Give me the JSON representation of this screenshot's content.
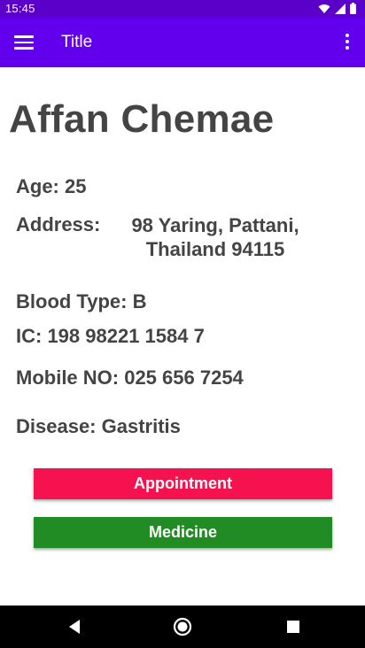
{
  "status_bar": {
    "time": "15:45"
  },
  "app_bar": {
    "title": "Title"
  },
  "profile": {
    "name": "Affan Chemae",
    "age": "Age: 25",
    "address_label": "Address:",
    "address_line1": "98 Yaring, Pattani,",
    "address_line2": "Thailand 94115",
    "blood_type": "Blood Type: B",
    "ic": "IC: 198 98221 1584 7",
    "mobile": "Mobile NO: 025 656 7254",
    "disease": "Disease: Gastritis"
  },
  "actions": {
    "appointment_label": "Appointment",
    "medicine_label": "Medicine"
  },
  "colors": {
    "status_bar": "#5b00c9",
    "app_bar": "#6200ee",
    "appointment_button": "#f5124e",
    "medicine_button": "#218b24",
    "nav_bar": "#000000"
  },
  "icons": [
    "wifi-icon",
    "signal-icon",
    "battery-icon",
    "menu-icon",
    "more-vert-icon",
    "back-icon",
    "home-icon",
    "recents-icon"
  ]
}
